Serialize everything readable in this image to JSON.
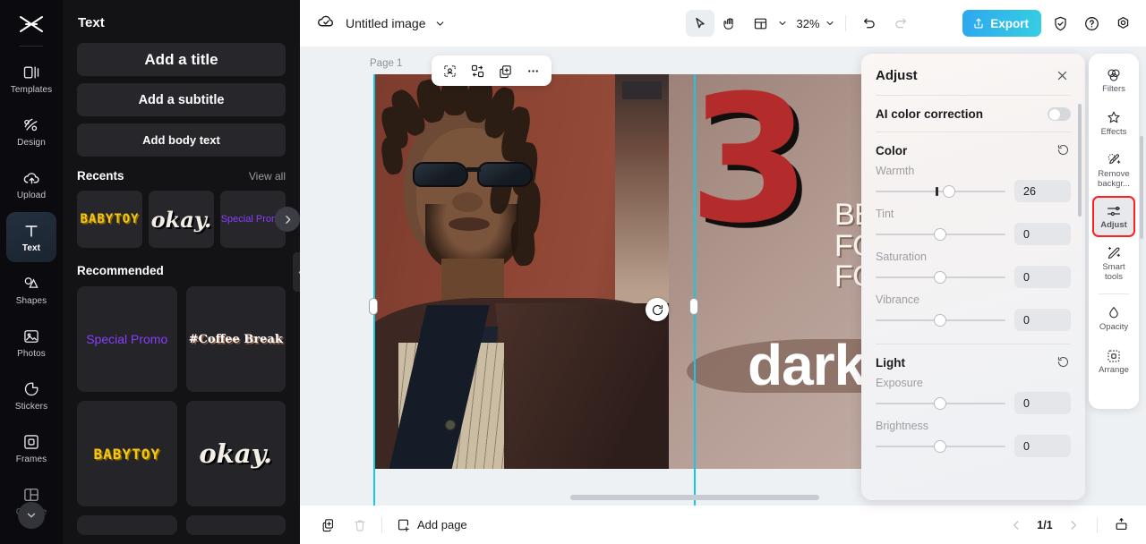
{
  "app": {
    "logo_icon": "capcut-logo-icon"
  },
  "rail": {
    "items": [
      {
        "label": "Templates",
        "icon": "templates-icon",
        "active": false
      },
      {
        "label": "Design",
        "icon": "design-icon",
        "active": false
      },
      {
        "label": "Upload",
        "icon": "upload-cloud-icon",
        "active": false
      },
      {
        "label": "Text",
        "icon": "text-icon",
        "active": true
      },
      {
        "label": "Shapes",
        "icon": "shapes-icon",
        "active": false
      },
      {
        "label": "Photos",
        "icon": "photos-icon",
        "active": false
      },
      {
        "label": "Stickers",
        "icon": "stickers-icon",
        "active": false
      },
      {
        "label": "Frames",
        "icon": "frames-icon",
        "active": false
      },
      {
        "label": "Collage",
        "icon": "collage-icon",
        "active": false
      }
    ],
    "more_icon": "chevron-down-icon"
  },
  "text_panel": {
    "title": "Text",
    "add_title": "Add a title",
    "add_subtitle": "Add a subtitle",
    "add_body": "Add body text",
    "recents_label": "Recents",
    "view_all": "View all",
    "recents": [
      {
        "text": "BABYTOY",
        "style": "babytoy"
      },
      {
        "text": "okay.",
        "style": "okay"
      },
      {
        "text": "Special Promo",
        "style": "special"
      }
    ],
    "carousel_next_icon": "chevron-right-icon",
    "recommended_label": "Recommended",
    "recommended": [
      {
        "text": "Special Promo",
        "style": "special"
      },
      {
        "text": "#Coffee Break",
        "style": "coffee"
      },
      {
        "text": "BABYTOY",
        "style": "babytoy"
      },
      {
        "text": "okay.",
        "style": "okay"
      }
    ],
    "collapse_icon": "chevron-left-icon"
  },
  "topbar": {
    "cloud_icon": "cloud-saved-icon",
    "doc_name": "Untitled image",
    "doc_caret_icon": "chevron-down-icon",
    "select_tool_icon": "cursor-arrow-icon",
    "hand_tool_icon": "hand-icon",
    "layout_tool_icon": "layout-icon",
    "layout_caret_icon": "chevron-down-icon",
    "zoom_value": "32%",
    "zoom_caret_icon": "chevron-down-icon",
    "undo_icon": "undo-icon",
    "redo_icon": "redo-icon",
    "export_label": "Export",
    "export_icon": "share-up-icon",
    "shield_icon": "shield-check-icon",
    "help_icon": "question-circle-icon",
    "settings_icon": "gear-icon"
  },
  "canvas": {
    "page_label": "Page 1",
    "float_toolbar": [
      {
        "icon": "cutout-icon"
      },
      {
        "icon": "auto-layout-icon"
      },
      {
        "icon": "duplicate-icon"
      },
      {
        "icon": "more-horizontal-icon"
      }
    ],
    "rotate_handle_icon": "rotate-icon",
    "artwork": {
      "number": "3",
      "headline": "BEST\nFOR\nFOR",
      "word": "dark"
    }
  },
  "bottombar": {
    "duplicate_icon": "duplicate-page-icon",
    "delete_icon": "trash-icon",
    "add_page_icon": "add-page-icon",
    "add_page_label": "Add page",
    "prev_icon": "chevron-left-icon",
    "page_indicator": "1/1",
    "next_icon": "chevron-right-icon",
    "present_icon": "present-icon"
  },
  "adjust_panel": {
    "title": "Adjust",
    "close_icon": "close-icon",
    "ai_color_correction": {
      "label": "AI color correction",
      "enabled": false
    },
    "groups": [
      {
        "name": "Color",
        "reset_icon": "reset-icon",
        "controls": [
          {
            "label": "Warmth",
            "value": "26",
            "pos": 52
          },
          {
            "label": "Tint",
            "value": "0",
            "pos": 50
          },
          {
            "label": "Saturation",
            "value": "0",
            "pos": 50
          },
          {
            "label": "Vibrance",
            "value": "0",
            "pos": 50
          }
        ]
      },
      {
        "name": "Light",
        "reset_icon": "reset-icon",
        "controls": [
          {
            "label": "Exposure",
            "value": "0",
            "pos": 50
          },
          {
            "label": "Brightness",
            "value": "0",
            "pos": 50
          }
        ]
      }
    ]
  },
  "tools_panel": {
    "items": [
      {
        "label": "Filters",
        "icon": "filters-icon",
        "active": false
      },
      {
        "label": "Effects",
        "icon": "effects-icon",
        "active": false
      },
      {
        "label": "Remove backgr...",
        "icon": "remove-background-icon",
        "active": false
      },
      {
        "label": "Adjust",
        "icon": "adjust-sliders-icon",
        "active": true
      },
      {
        "label": "Smart tools",
        "icon": "smart-tools-icon",
        "active": false
      },
      {
        "label": "Opacity",
        "icon": "opacity-icon",
        "active": false
      },
      {
        "label": "Arrange",
        "icon": "arrange-icon",
        "active": false
      }
    ]
  },
  "colors": {
    "accent_cyan": "#17c7e8",
    "export_gradient_start": "#2da7f0",
    "export_gradient_end": "#35cfe2",
    "active_tool_outline": "#ff1f1f",
    "rail_bg": "#0b0b0f",
    "panel_bg": "#131316"
  }
}
